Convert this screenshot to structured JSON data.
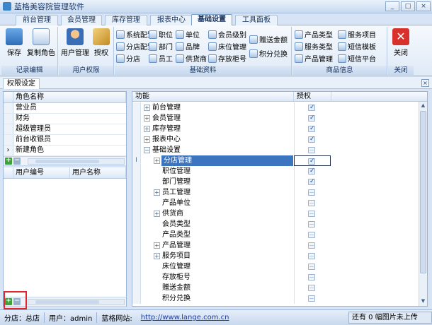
{
  "window": {
    "title": "蓝格美容院管理软件"
  },
  "tabs": [
    "前台管理",
    "会员管理",
    "库存管理",
    "报表中心",
    "基础设置",
    "工具面板"
  ],
  "ribbon": {
    "record_group": {
      "label": "记录编辑",
      "save": "保存",
      "copy_role": "复制角色"
    },
    "permission_group": {
      "label": "用户权限",
      "user_mgmt": "用户管理",
      "authorize": "授权"
    },
    "basic_group": {
      "label": "基础资料",
      "items": [
        "系统配置",
        "职位",
        "单位",
        "会员级别",
        "赠送金额",
        "分店配置",
        "部门",
        "品牌",
        "床位管理",
        "积分兑换",
        "分店",
        "员工",
        "供货商",
        "存放柜号"
      ]
    },
    "product_group": {
      "label": "商品信息",
      "items": [
        "产品类型",
        "服务项目",
        "服务类型",
        "短信模板",
        "产品管理",
        "短信平台"
      ]
    },
    "close_group": {
      "label": "关闭",
      "close": "关闭"
    }
  },
  "subtab": {
    "label": "权限设定"
  },
  "role_grid": {
    "header": "角色名称",
    "rows": [
      "营业员",
      "财务",
      "超级管理员",
      "前台收银员",
      "新建角色"
    ]
  },
  "user_grid": {
    "col1": "用户编号",
    "col2": "用户名称"
  },
  "tree": {
    "col_func": "功能",
    "col_auth": "授权",
    "rows": [
      {
        "label": "前台管理",
        "checked": true
      },
      {
        "label": "会员管理",
        "checked": true
      },
      {
        "label": "库存管理",
        "checked": true
      },
      {
        "label": "报表中心",
        "checked": true
      },
      {
        "label": "基础设置",
        "checked": false
      },
      {
        "label": "分店管理",
        "checked": true
      },
      {
        "label": "职位管理",
        "checked": true
      },
      {
        "label": "部门管理",
        "checked": true
      },
      {
        "label": "员工管理",
        "checked": false
      },
      {
        "label": "产品单位",
        "checked": false
      },
      {
        "label": "供货商",
        "checked": false
      },
      {
        "label": "会员类型",
        "checked": false
      },
      {
        "label": "产品类型",
        "checked": false
      },
      {
        "label": "产品管理",
        "checked": false
      },
      {
        "label": "服务项目",
        "checked": false
      },
      {
        "label": "床位管理",
        "checked": false
      },
      {
        "label": "存放柜号",
        "checked": false
      },
      {
        "label": "赠送金额",
        "checked": false
      },
      {
        "label": "积分兑换",
        "checked": false
      }
    ]
  },
  "status": {
    "branch": "分店：总店",
    "user": "用户：admin",
    "site_label": "蓝格网站:",
    "site_url": "http://www.lange.com.cn",
    "upload": "还有 0 幅图片未上传"
  },
  "colors": {
    "accent": "#3c74c0",
    "highlight_box": "#e3262c"
  }
}
